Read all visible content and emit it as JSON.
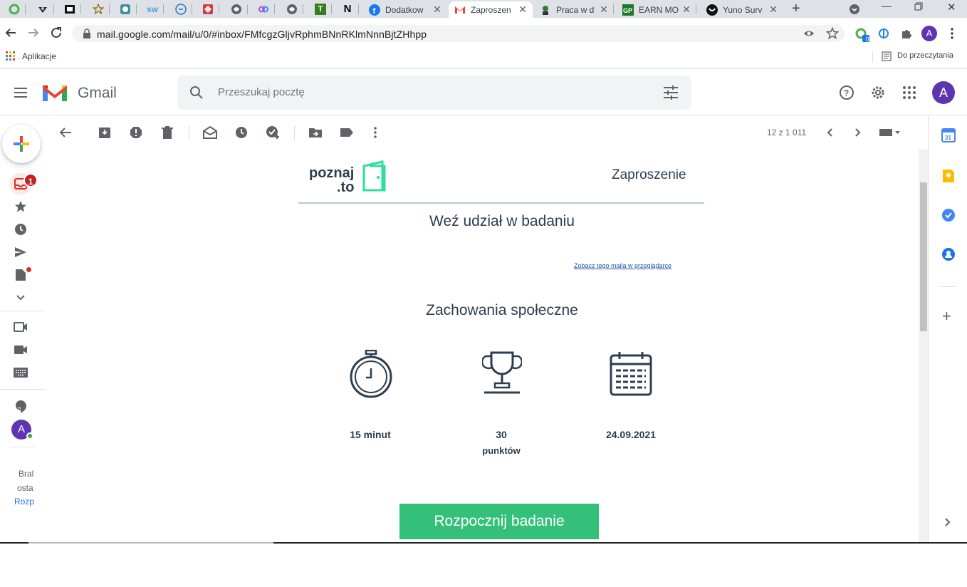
{
  "browser": {
    "tabs": [
      {
        "title": "Dodatkow",
        "icon": "facebook-icon"
      },
      {
        "title": "Zaproszen",
        "icon": "gmail-icon",
        "active": true
      },
      {
        "title": "Praca w d",
        "icon": "worker-icon"
      },
      {
        "title": "EARN MO",
        "icon": "gp-icon"
      },
      {
        "title": "Yuno Surv",
        "icon": "yuno-icon"
      }
    ],
    "pinned_icons": [
      "refresh-circle-icon",
      "ninja-icon",
      "camera-icon",
      "star-icon",
      "robot-icon",
      "sw-icon",
      "chat-icon",
      "diamond-icon",
      "globe-icon",
      "link-icon",
      "globe-icon",
      "t-icon",
      "n-icon"
    ],
    "pinned_letters": {
      "t": "T",
      "n": "N",
      "sw": "sw"
    },
    "url": "mail.google.com/mail/u/0/#inbox/FMfcgzGljvRphmBNnRKlmNnnBjtZHhpp",
    "bookmarks_apps": "Aplikacje",
    "reading_list": "Do przeczytania",
    "ext_badge": "0",
    "profile_letter": "A"
  },
  "gmail": {
    "logo_text": "Gmail",
    "search_placeholder": "Przeszukaj pocztę",
    "inbox_badge": "1",
    "account_letter": "A",
    "pagination": "12 z 1 011",
    "hangouts_lines": [
      "Bral",
      "osta",
      "Rozp"
    ]
  },
  "email": {
    "brand_line1": "poznaj",
    "brand_line2": ".to",
    "header_label": "Zaproszenie",
    "headline": "Weź udział w badaniu",
    "browser_link": "Zobacz tego maila w przeglądarce",
    "survey_title": "Zachowania społeczne",
    "stats": [
      {
        "value": "15 minut",
        "sub": "",
        "icon": "stopwatch-icon"
      },
      {
        "value": "30",
        "sub": "punktów",
        "icon": "trophy-icon"
      },
      {
        "value": "24.09.2021",
        "sub": "",
        "icon": "calendar-icon"
      }
    ],
    "cta_label": "Rozpocznij badanie"
  },
  "colors": {
    "accent_green": "#35c07a",
    "brand_green": "#2ddf9c",
    "text_dark": "#2c3e50",
    "gmail_red": "#c5221f"
  }
}
